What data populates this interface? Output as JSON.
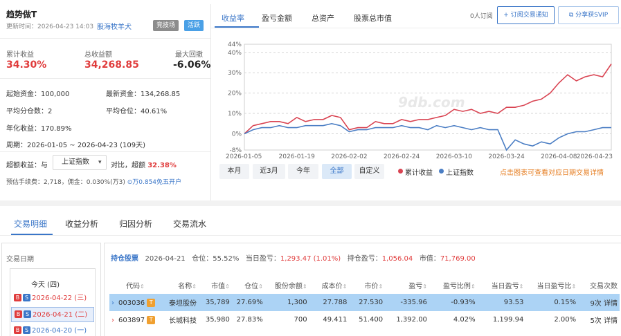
{
  "portfolio": {
    "title": "趋势做T",
    "update_time": "更新时间：2026-04-23 14:03",
    "author": "股海牧羊犬",
    "tags": [
      "竞技场",
      "活跃"
    ]
  },
  "metrics": {
    "cum_return_label": "累计收益",
    "cum_return": "34.30%",
    "total_profit_label": "总收益额",
    "total_profit": "34,268.85",
    "max_drawdown_label": "最大回撤",
    "max_drawdown": "-6.06%"
  },
  "info": {
    "start_capital": "起始资金：100,000",
    "latest_capital": "最新资金：134,268.85",
    "avg_shares": "平均分仓数：2",
    "avg_position": "平均仓位：40.61%",
    "annual_return": "年化收益：170.89%",
    "period": "周期：2026-01-05 ~ 2026-04-23 (109天)"
  },
  "excess": {
    "label": "超额收益：与",
    "benchmark": "上证指数",
    "compare": "对比，超额",
    "value": "32.38%",
    "fee_text": "预估手续费：2,718，佣金：0.030%(万3)",
    "fee_link": "万0.854免五开户"
  },
  "chart_tabs": [
    "收益率",
    "盈亏金额",
    "总资产",
    "股票总市值"
  ],
  "subscribe": {
    "count": "0人订阅",
    "subscribe_btn": "+ 订阅交易通知",
    "share_btn": "分享获SVIP"
  },
  "period_buttons": [
    "本月",
    "近3月",
    "今年",
    "全部",
    "自定义"
  ],
  "legend": {
    "series1": "累计收益",
    "series2": "上证指数"
  },
  "hint": "点击图表可查看对应日期交易详情",
  "watermark": "9db.com",
  "chart_data": {
    "type": "line",
    "x": [
      "2026-01-05",
      "2026-01-07",
      "2026-01-09",
      "2026-01-12",
      "2026-01-14",
      "2026-01-16",
      "2026-01-19",
      "2026-01-21",
      "2026-01-23",
      "2026-01-26",
      "2026-01-28",
      "2026-01-30",
      "2026-02-02",
      "2026-02-04",
      "2026-02-06",
      "2026-02-09",
      "2026-02-11",
      "2026-02-13",
      "2026-02-24",
      "2026-02-26",
      "2026-02-28",
      "2026-03-02",
      "2026-03-04",
      "2026-03-06",
      "2026-03-10",
      "2026-03-12",
      "2026-03-14",
      "2026-03-17",
      "2026-03-19",
      "2026-03-21",
      "2026-03-24",
      "2026-03-26",
      "2026-03-28",
      "2026-03-31",
      "2026-04-02",
      "2026-04-04",
      "2026-04-08",
      "2026-04-10",
      "2026-04-14",
      "2026-04-16",
      "2026-04-18",
      "2026-04-21",
      "2026-04-23"
    ],
    "series": [
      {
        "name": "累计收益",
        "color": "#d94452",
        "values": [
          0,
          4,
          5,
          6,
          6,
          5,
          8,
          6,
          7,
          7,
          9,
          8,
          2,
          3,
          3,
          6,
          5,
          5,
          7,
          6,
          7,
          7,
          8,
          9,
          12,
          11,
          12,
          10,
          11,
          10,
          13,
          13,
          14,
          16,
          17,
          20,
          25,
          29,
          26,
          28,
          29,
          28,
          34.3
        ]
      },
      {
        "name": "上证指数",
        "color": "#4b7ec4",
        "values": [
          0,
          2,
          3,
          3,
          4,
          3,
          3,
          4,
          4,
          4,
          5,
          4,
          1,
          2,
          2,
          3,
          3,
          3,
          4,
          3,
          3,
          2,
          4,
          3,
          4,
          3,
          2,
          3,
          2,
          2,
          -8,
          -3,
          -5,
          -6,
          -4,
          -5,
          -2,
          0,
          1,
          1,
          2,
          3,
          3
        ]
      }
    ],
    "x_ticks": [
      "2026-01-05",
      "2026-01-19",
      "2026-02-02",
      "2026-02-24",
      "2026-03-10",
      "2026-03-24",
      "2026-04-08",
      "2026-04-23"
    ],
    "y_ticks": [
      "44%",
      "40%",
      "30%",
      "20%",
      "10%",
      "0%",
      "-8%"
    ],
    "ylim": [
      -8,
      44
    ],
    "grid": true
  },
  "bottom_tabs": [
    "交易明细",
    "收益分析",
    "归因分析",
    "交易流水"
  ],
  "dates": {
    "title": "交易日期",
    "today": "今天 (四)",
    "items": [
      {
        "date": "2026-04-22 (三)",
        "b": "B",
        "s": "S"
      },
      {
        "date": "2026-04-21 (二)",
        "b": "B",
        "s": "S"
      },
      {
        "date": "2026-04-20 (一)",
        "b": "B",
        "s": "S"
      }
    ]
  },
  "holdings_header": {
    "label": "持仓股票",
    "date": "2026-04-21",
    "position": "仓位：55.52%",
    "day_pl_label": "当日盈亏：",
    "day_pl": "1,293.47 (1.01%)",
    "hold_pl_label": "持仓盈亏：",
    "hold_pl": "1,056.04",
    "mkt_value_label": "市值：",
    "mkt_value": "71,769.00"
  },
  "table": {
    "columns": [
      "代码",
      "名称",
      "市值",
      "仓位",
      "股份余额",
      "成本价",
      "市价",
      "盈亏",
      "盈亏比例",
      "当日盈亏",
      "当日盈亏比",
      "交易次数"
    ],
    "rows": [
      {
        "code": "003036",
        "badge": "T",
        "name": "泰坦股份",
        "mv": "35,789",
        "pos": "27.69%",
        "shares": "1,300",
        "cost": "27.788",
        "price": "27.530",
        "pl": "-335.96",
        "plr": "-0.93%",
        "dpl": "93.53",
        "dplr": "0.15%",
        "trades": "9次",
        "detail": "详情"
      },
      {
        "code": "603897",
        "badge": "T",
        "name": "长城科技",
        "mv": "35,980",
        "pos": "27.83%",
        "shares": "700",
        "cost": "49.411",
        "price": "51.400",
        "pl": "1,392.00",
        "plr": "4.02%",
        "dpl": "1,199.94",
        "dplr": "2.00%",
        "trades": "5次",
        "detail": "详情"
      }
    ]
  }
}
